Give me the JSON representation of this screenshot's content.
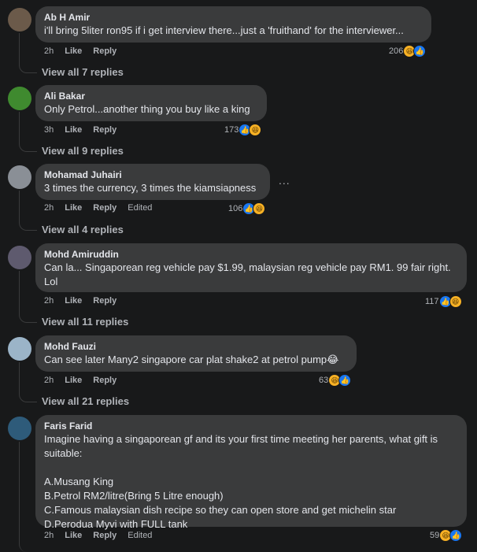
{
  "comments": [
    {
      "author": "Ab H Amir",
      "text": "i'll bring 5liter ron95 if i get interview there...just a 'fruithand' for the interviewer...",
      "time": "2h",
      "like": "Like",
      "reply": "Reply",
      "edited": "",
      "reactions": "206",
      "view_replies": "View all 7 replies",
      "avatar_color": "#6b5a4a"
    },
    {
      "author": "Ali Bakar",
      "text": "Only Petrol...another thing you buy like a king",
      "time": "3h",
      "like": "Like",
      "reply": "Reply",
      "edited": "",
      "reactions": "173",
      "view_replies": "View all 9 replies",
      "avatar_color": "#3f8a2f"
    },
    {
      "author": "Mohamad Juhairi",
      "text": "3 times the currency, 3 times the kiamsiapness",
      "time": "2h",
      "like": "Like",
      "reply": "Reply",
      "edited": "Edited",
      "reactions": "106",
      "view_replies": "View all 4 replies",
      "avatar_color": "#8a8f96"
    },
    {
      "author": "Mohd Amiruddin",
      "text": "Can la... Singaporean reg vehicle pay $1.99, malaysian reg vehicle pay RM1. 99 fair right.\nLol",
      "time": "2h",
      "like": "Like",
      "reply": "Reply",
      "edited": "",
      "reactions": "117",
      "view_replies": "View all 11 replies",
      "avatar_color": "#5e5a6e"
    },
    {
      "author": "Mohd Fauzi",
      "text": "Can see later Many2 singapore car plat shake2 at petrol pump😂",
      "time": "2h",
      "like": "Like",
      "reply": "Reply",
      "edited": "",
      "reactions": "63",
      "view_replies": "View all 21 replies",
      "avatar_color": "#9bb4c8"
    },
    {
      "author": "Faris Farid",
      "text": "Imagine having a singaporean gf and its your first time meeting her parents, what gift is\nsuitable:\n\nA.Musang King\nB.Petrol RM2/litre(Bring 5 Litre enough)\nC.Famous malaysian dish recipe so they can open store and get michelin star\nD.Perodua Myvi with FULL tank",
      "time": "2h",
      "like": "Like",
      "reply": "Reply",
      "edited": "Edited",
      "reactions": "59",
      "view_replies": "",
      "avatar_color": "#2e5b7a"
    }
  ],
  "more_options": "...",
  "colors": {
    "bubble": "#3a3b3c",
    "background": "#18191a",
    "like_blue": "#1877f2",
    "haha_yellow": "#f7b125"
  }
}
